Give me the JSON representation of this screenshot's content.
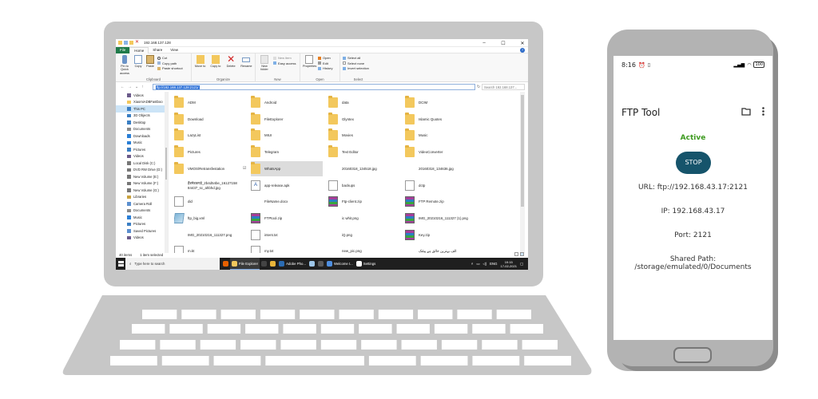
{
  "explorer": {
    "window_title": "192.168.137.128",
    "tabs": [
      "File",
      "Home",
      "Share",
      "View"
    ],
    "ribbon": {
      "clipboard": {
        "label": "Clipboard",
        "pin": "Pin to Quick access",
        "copy": "Copy",
        "paste": "Paste",
        "cut": "Cut",
        "copy_path": "Copy path",
        "paste_shortcut": "Paste shortcut"
      },
      "organize": {
        "label": "Organize",
        "move_to": "Move to",
        "copy_to": "Copy to",
        "delete": "Delete",
        "rename": "Rename"
      },
      "new": {
        "label": "New",
        "new_folder": "New folder",
        "new_item": "New item",
        "easy_access": "Easy access"
      },
      "open": {
        "label": "Open",
        "properties": "Properties",
        "open": "Open",
        "edit": "Edit",
        "history": "History"
      },
      "select": {
        "label": "Select",
        "select_all": "Select all",
        "select_none": "Select none",
        "invert": "Invert selection"
      }
    },
    "address": "ftp://192.168.137.128:2121/",
    "search_placeholder": "Search 192.168.137...",
    "nav": [
      {
        "label": "Videos",
        "icon": "video-icon",
        "color": "#6b5a8a"
      },
      {
        "label": "XiaomiADBFastboo",
        "icon": "folder-icon",
        "color": "#f3c85d"
      },
      {
        "label": "This PC",
        "icon": "computer-icon",
        "color": "#3b7fc4"
      },
      {
        "label": "3D Objects",
        "icon": "cube-icon",
        "color": "#3b7fc4"
      },
      {
        "label": "Desktop",
        "icon": "desktop-icon",
        "color": "#3b7fc4"
      },
      {
        "label": "Documents",
        "icon": "documents-icon",
        "color": "#8a8a8a"
      },
      {
        "label": "Downloads",
        "icon": "download-icon",
        "color": "#2a7fd6"
      },
      {
        "label": "Music",
        "icon": "music-icon",
        "color": "#2a7fd6"
      },
      {
        "label": "Pictures",
        "icon": "pictures-icon",
        "color": "#3b7fc4"
      },
      {
        "label": "Videos",
        "icon": "video-icon",
        "color": "#6b5a8a"
      },
      {
        "label": "Local Disk (C:)",
        "icon": "drive-icon",
        "color": "#777"
      },
      {
        "label": "DVD RW Drive (D:)",
        "icon": "dvd-icon",
        "color": "#777"
      },
      {
        "label": "New Volume (E:)",
        "icon": "drive-icon",
        "color": "#777"
      },
      {
        "label": "New Volume (F:)",
        "icon": "drive-icon",
        "color": "#777"
      },
      {
        "label": "New Volume (G:)",
        "icon": "drive-icon",
        "color": "#777"
      },
      {
        "label": "Libraries",
        "icon": "library-icon",
        "color": "#c9a23f"
      },
      {
        "label": "Camera Roll",
        "icon": "folder-icon",
        "color": "#5c8fcf"
      },
      {
        "label": "Documents",
        "icon": "documents-icon",
        "color": "#8a8a8a"
      },
      {
        "label": "Music",
        "icon": "music-icon",
        "color": "#2a7fd6"
      },
      {
        "label": "Pictures",
        "icon": "pictures-icon",
        "color": "#3b7fc4"
      },
      {
        "label": "Saved Pictures",
        "icon": "folder-icon",
        "color": "#5c8fcf"
      },
      {
        "label": "Videos",
        "icon": "video-icon",
        "color": "#6b5a8a"
      }
    ],
    "nav_selected": 2,
    "files": [
      {
        "name": "ADM",
        "type": "folder"
      },
      {
        "name": "Android",
        "type": "folder"
      },
      {
        "name": "data",
        "type": "folder"
      },
      {
        "name": "DCIM",
        "type": "folder"
      },
      {
        "name": "Download",
        "type": "folder"
      },
      {
        "name": "FileExplorer",
        "type": "folder"
      },
      {
        "name": "Glyntex",
        "type": "folder"
      },
      {
        "name": "Islamic Quotes",
        "type": "folder"
      },
      {
        "name": "LazyList",
        "type": "folder"
      },
      {
        "name": "MIUI",
        "type": "folder"
      },
      {
        "name": "Movies",
        "type": "folder"
      },
      {
        "name": "Music",
        "type": "folder"
      },
      {
        "name": "Pictures",
        "type": "folder"
      },
      {
        "name": "Telegram",
        "type": "folder"
      },
      {
        "name": "Text Editor",
        "type": "folder"
      },
      {
        "name": "VideoConverter",
        "type": "folder"
      },
      {
        "name": "VMOS\\Retransfestation",
        "type": "folder"
      },
      {
        "name": "WhatsApp",
        "type": "folder",
        "selected": true
      },
      {
        "name": "20160318_134518.jpg",
        "type": "image"
      },
      {
        "name": "20160318_134636.jpg",
        "type": "image"
      },
      {
        "name": "हैंडमेडकपड़े_2b4d54be_16127158 84437_sc_ahbhd.jpg",
        "type": "image"
      },
      {
        "name": "app-release.apk",
        "type": "apk"
      },
      {
        "name": "backups",
        "type": "doc"
      },
      {
        "name": "dctp",
        "type": "doc"
      },
      {
        "name": "did",
        "type": "doc"
      },
      {
        "name": "FileName.docx",
        "type": "image"
      },
      {
        "name": "Ftp-client.zip",
        "type": "zip"
      },
      {
        "name": "FTP Remote.zip",
        "type": "zip"
      },
      {
        "name": "ftp_big.xml",
        "type": "xml"
      },
      {
        "name": "FTPtool.zip",
        "type": "zip"
      },
      {
        "name": "ic whit.png",
        "type": "image"
      },
      {
        "name": "IMG_20210216_111327 (1).png",
        "type": "zip"
      },
      {
        "name": "IMG_20210216_111327.png",
        "type": "image"
      },
      {
        "name": "intent.txt",
        "type": "doc"
      },
      {
        "name": "iQ.png",
        "type": "image"
      },
      {
        "name": "Key.zip",
        "type": "zip"
      },
      {
        "name": "m.kt",
        "type": "doc"
      },
      {
        "name": "my.txt",
        "type": "doc"
      },
      {
        "name": "new_pic.png",
        "type": "image"
      },
      {
        "name": "الف بہترین خالق ہے پیٹنک",
        "type": "image"
      }
    ],
    "status": {
      "count": "40 items",
      "selected": "1 item selected"
    },
    "taskbar": {
      "search": "Type here to search",
      "apps": [
        {
          "label": "",
          "icon": "firefox-icon",
          "color": "#e66000"
        },
        {
          "label": "File Explorer",
          "icon": "folder-icon",
          "color": "#f3c85d",
          "active": true
        },
        {
          "label": "",
          "icon": "record-icon",
          "color": "#444"
        },
        {
          "label": "",
          "icon": "chrome-icon",
          "color": "#e8b43a"
        },
        {
          "label": "Adobe Pho...",
          "icon": "photoshop-icon",
          "color": "#2b6cb3"
        },
        {
          "label": "",
          "icon": "notepad-icon",
          "color": "#9ec6e8"
        },
        {
          "label": "",
          "icon": "phone-icon",
          "color": "#5a5a5a"
        },
        {
          "label": "Welcome t...",
          "icon": "chrome-icon",
          "color": "#4f8fe0"
        },
        {
          "label": "Settings",
          "icon": "gear-icon",
          "color": "#ffffff"
        }
      ],
      "lang": "ENG",
      "time": "19:15",
      "date": "17-02-2021"
    }
  },
  "phone": {
    "time": "8:16",
    "battery": "100",
    "app_title": "FTP Tool",
    "status": "Active",
    "button": "STOP",
    "url": "URL: ftp://192.168.43.17:2121",
    "ip": "IP: 192.168.43.17",
    "port": "Port: 2121",
    "shared_path": "Shared Path: /storage/emulated/0/Documents"
  }
}
